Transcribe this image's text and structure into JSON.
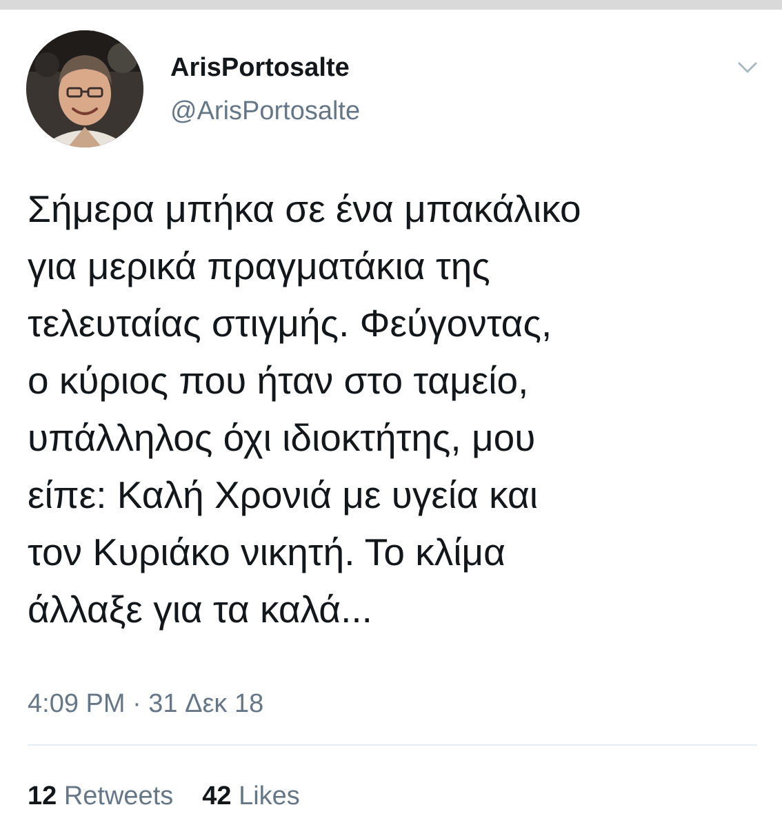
{
  "tweet": {
    "display_name": "ArisPortosalte",
    "handle": "@ArisPortosalte",
    "text": "Σήμερα μπήκα σε ένα μπακάλικο\nγια μερικά πραγματάκια της\nτελευταίας στιγμής. Φεύγοντας,\nο κύριος που ήταν στο ταμείο,\nυπάλληλος όχι ιδιοκτήτης, μου\nείπε: Καλή Χρονιά με υγεία και\nτον Κυριάκο νικητή. Το κλίμα\nάλλαξε για τα καλά...",
    "timestamp": "4:09 PM · 31 Δεκ 18",
    "retweets_count": "12",
    "retweets_label": "Retweets",
    "likes_count": "42",
    "likes_label": "Likes",
    "menu_icon": "chevron-down-icon",
    "avatar_icon": "avatar"
  },
  "colors": {
    "primary_text": "#14171a",
    "secondary_text": "#657786",
    "divider": "#e6ecf0",
    "chevron": "#aab8c2"
  }
}
